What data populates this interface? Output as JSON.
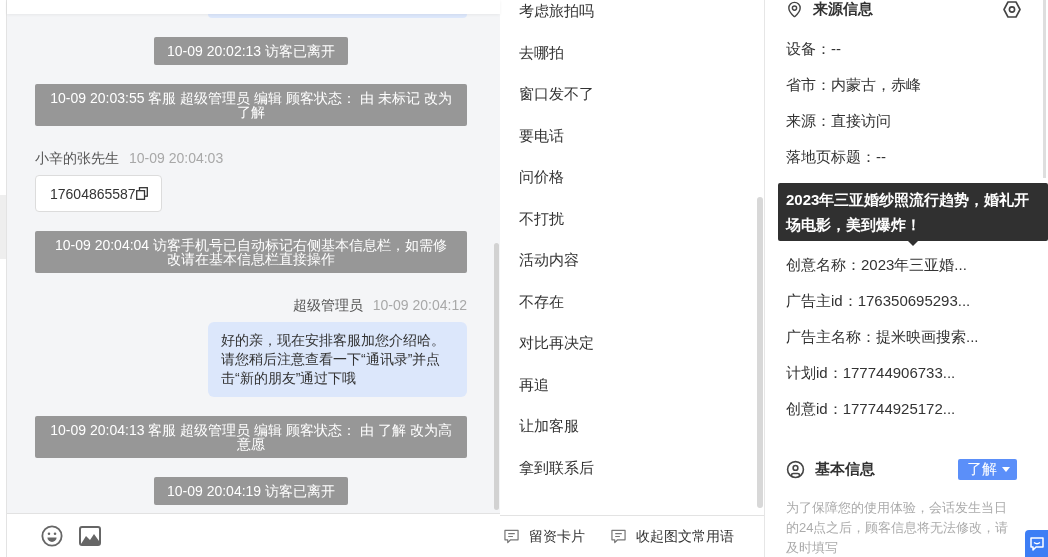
{
  "chat": {
    "messages": [
      {
        "kind": "notice",
        "text": "10-09 20:02:13 访客已离开"
      },
      {
        "kind": "event",
        "text": "10-09 20:03:55 客服 超级管理员 编辑 顾客状态： 由 未标记 改为了解"
      },
      {
        "kind": "visitor",
        "sender": "小辛的张先生",
        "time": "10-09 20:04:03",
        "text": "17604865587"
      },
      {
        "kind": "event",
        "text": "10-09 20:04:04 访客手机号已自动标记右侧基本信息栏，如需修改请在基本信息栏直接操作"
      },
      {
        "kind": "agent",
        "sender": "超级管理员",
        "time": "10-09 20:04:12",
        "text": "好的亲，现在安排客服加您介绍哈。请您稍后注意查看一下“通讯录”并点击“新的朋友”通过下哦"
      },
      {
        "kind": "event",
        "text": "10-09 20:04:13 客服 超级管理员 编辑 顾客状态： 由 了解 改为高意愿"
      },
      {
        "kind": "notice",
        "text": "10-09 20:04:19 访客已离开"
      }
    ]
  },
  "quick_phrases": {
    "items": [
      "考虑旅拍吗",
      "去哪拍",
      "窗口发不了",
      "要电话",
      "问价格",
      "不打扰",
      "活动内容",
      "不存在",
      "对比再决定",
      "再追",
      "让加客服",
      "拿到联系后"
    ],
    "footer_buttons": [
      "留资卡片",
      "收起图文常用语"
    ]
  },
  "source_info": {
    "title": "来源信息",
    "fields": [
      {
        "text": "设备：--"
      },
      {
        "text": "省市：内蒙古，赤峰"
      },
      {
        "text": "来源：直接访问"
      },
      {
        "text": "落地页标题：--"
      },
      {
        "text": "创意名称：2023年三亚婚...",
        "tooltip": "2023年三亚婚纱照流行趋势，婚礼开场电影，美到爆炸！"
      },
      {
        "text": "广告主id：176350695293..."
      },
      {
        "text": "广告主名称：提米映画搜索..."
      },
      {
        "text": "计划id：177744906733..."
      },
      {
        "text": "创意id：177744925172..."
      }
    ]
  },
  "basic_info": {
    "title": "基本信息",
    "status": "了解",
    "note": "为了保障您的使用体验，会话发生当日的24点之后，顾客信息将无法修改，请及时填写"
  }
}
